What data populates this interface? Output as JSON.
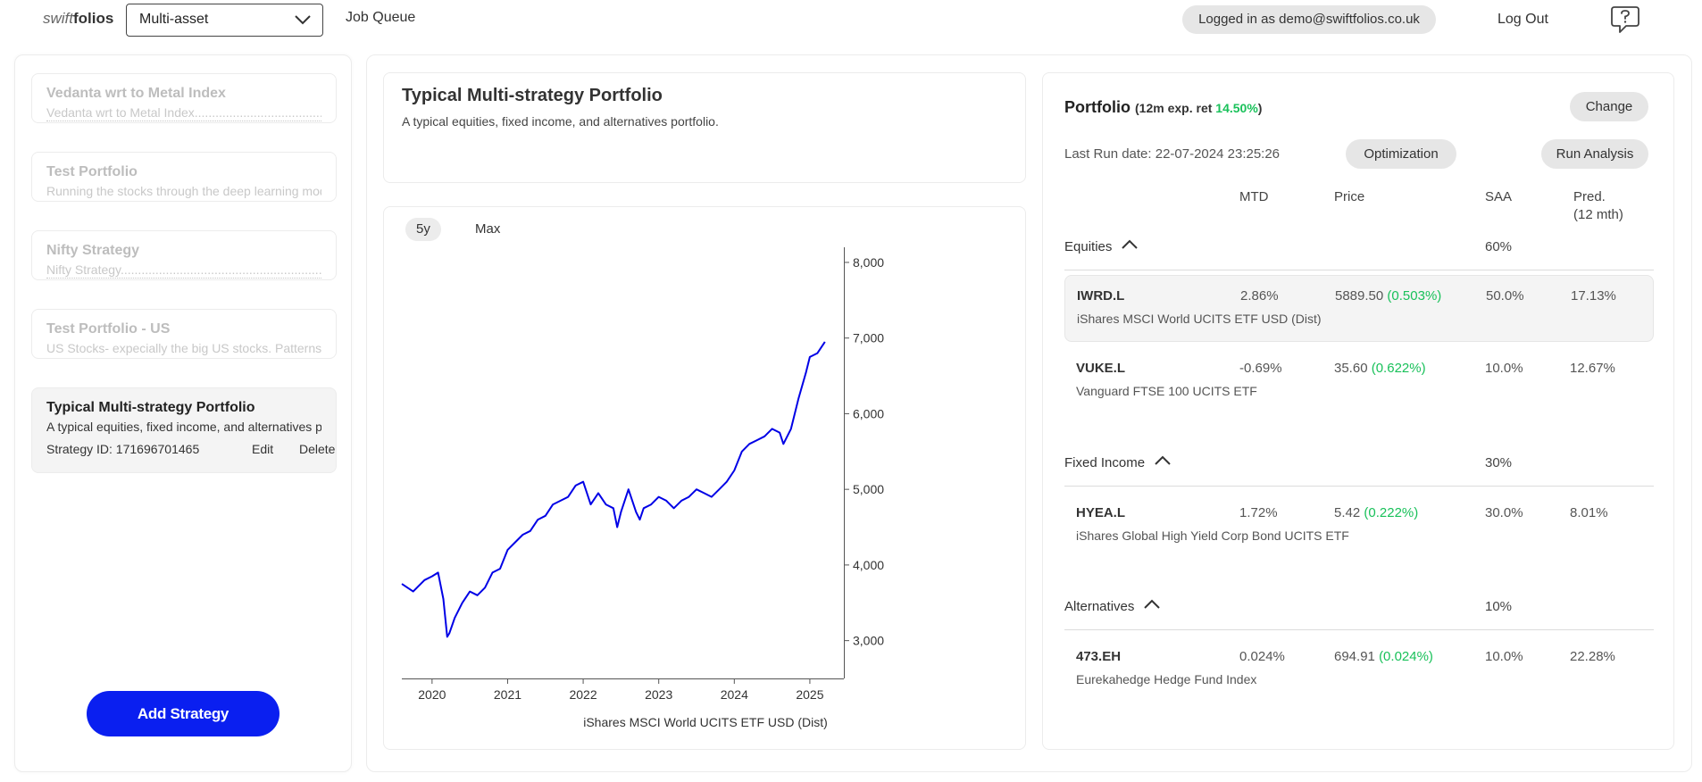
{
  "header": {
    "logo_part1": "swift",
    "logo_part2": "folios",
    "asset_select": "Multi-asset",
    "job_queue": "Job Queue",
    "login_text": "Logged in as demo@swiftfolios.co.uk",
    "logout": "Log Out"
  },
  "sidebar": {
    "strategies": [
      {
        "title": "Vedanta wrt to Metal Index",
        "desc": "Vedanta wrt to Metal Index......................................................"
      },
      {
        "title": "Test Portfolio",
        "desc": "Running the stocks through the deep learning model"
      },
      {
        "title": "Nifty Strategy",
        "desc": "Nifty Strategy..............................................................................."
      },
      {
        "title": "Test Portfolio - US",
        "desc": "US Stocks- expecially the big US stocks. Patterns t"
      },
      {
        "title": "Typical Multi-strategy Portfolio",
        "desc": "A typical equities, fixed income, and alternatives portfolio.",
        "strategy_id": "Strategy ID: 171696701465",
        "edit": "Edit",
        "delete": "Delete"
      }
    ],
    "add_button": "Add Strategy"
  },
  "info": {
    "title": "Typical Multi-strategy Portfolio",
    "desc": "A typical equities, fixed income, and alternatives portfolio."
  },
  "chart_data": {
    "type": "line",
    "range_buttons": [
      "5y",
      "Max"
    ],
    "active_range": "5y",
    "xlabel": "iShares MSCI World UCITS ETF USD (Dist)",
    "x_ticks": [
      "2020",
      "2021",
      "2022",
      "2023",
      "2024",
      "2025"
    ],
    "y_ticks": [
      "3,000",
      "4,000",
      "5,000",
      "6,000",
      "7,000",
      "8,000"
    ],
    "ylim": [
      2500,
      8200
    ],
    "xlim": [
      2019.6,
      2025.45
    ],
    "series": [
      {
        "color": "#0000e6",
        "x": [
          2019.6,
          2019.75,
          2019.9,
          2020.0,
          2020.08,
          2020.15,
          2020.2,
          2020.23,
          2020.3,
          2020.4,
          2020.5,
          2020.6,
          2020.7,
          2020.8,
          2020.9,
          2021.0,
          2021.1,
          2021.2,
          2021.3,
          2021.4,
          2021.5,
          2021.6,
          2021.7,
          2021.8,
          2021.9,
          2022.0,
          2022.1,
          2022.2,
          2022.3,
          2022.4,
          2022.45,
          2022.5,
          2022.6,
          2022.7,
          2022.75,
          2022.8,
          2022.9,
          2023.0,
          2023.1,
          2023.2,
          2023.3,
          2023.4,
          2023.5,
          2023.6,
          2023.7,
          2023.8,
          2023.9,
          2024.0,
          2024.1,
          2024.2,
          2024.3,
          2024.4,
          2024.5,
          2024.6,
          2024.65,
          2024.75,
          2024.85,
          2024.95,
          2025.0,
          2025.1,
          2025.2
        ],
        "y": [
          3750,
          3650,
          3800,
          3850,
          3900,
          3550,
          3050,
          3100,
          3300,
          3500,
          3650,
          3600,
          3700,
          3900,
          3950,
          4200,
          4300,
          4400,
          4450,
          4600,
          4650,
          4800,
          4850,
          4900,
          5050,
          5100,
          4800,
          4950,
          4800,
          4750,
          4500,
          4700,
          5000,
          4700,
          4600,
          4750,
          4800,
          4900,
          4850,
          4750,
          4850,
          4900,
          5000,
          4950,
          4900,
          5000,
          5100,
          5250,
          5500,
          5600,
          5650,
          5700,
          5800,
          5750,
          5600,
          5800,
          6200,
          6550,
          6750,
          6800,
          6950
        ]
      }
    ]
  },
  "portfolio": {
    "title": "Portfolio",
    "sub_prefix": "(12m exp. ret ",
    "sub_value": "14.50%",
    "sub_suffix": ")",
    "change": "Change",
    "last_run": "Last Run date: 22-07-2024 23:25:26",
    "optimization": "Optimization",
    "run_analysis": "Run Analysis",
    "columns": {
      "mtd": "MTD",
      "price": "Price",
      "saa": "SAA",
      "pred_line1": "Pred.",
      "pred_line2": "(12 mth)"
    },
    "groups": [
      {
        "name": "Equities",
        "saa": "60%"
      },
      {
        "name": "Fixed Income",
        "saa": "30%"
      },
      {
        "name": "Alternatives",
        "saa": "10%"
      }
    ],
    "holdings": [
      {
        "ticker": "IWRD.L",
        "name": "iShares MSCI World UCITS ETF USD (Dist)",
        "mtd": "2.86%",
        "price": "5889.50",
        "chg": "(0.503%)",
        "saa": "50.0%",
        "pred": "17.13%"
      },
      {
        "ticker": "VUKE.L",
        "name": "Vanguard FTSE 100 UCITS ETF",
        "mtd": "-0.69%",
        "price": "35.60",
        "chg": "(0.622%)",
        "saa": "10.0%",
        "pred": "12.67%"
      },
      {
        "ticker": "HYEA.L",
        "name": "iShares Global High Yield Corp Bond UCITS ETF",
        "mtd": "1.72%",
        "price": "5.42",
        "chg": "(0.222%)",
        "saa": "30.0%",
        "pred": "8.01%"
      },
      {
        "ticker": "473.EH",
        "name": "Eurekahedge Hedge Fund Index",
        "mtd": "0.024%",
        "price": "694.91",
        "chg": "(0.024%)",
        "saa": "10.0%",
        "pred": "22.28%"
      }
    ]
  }
}
